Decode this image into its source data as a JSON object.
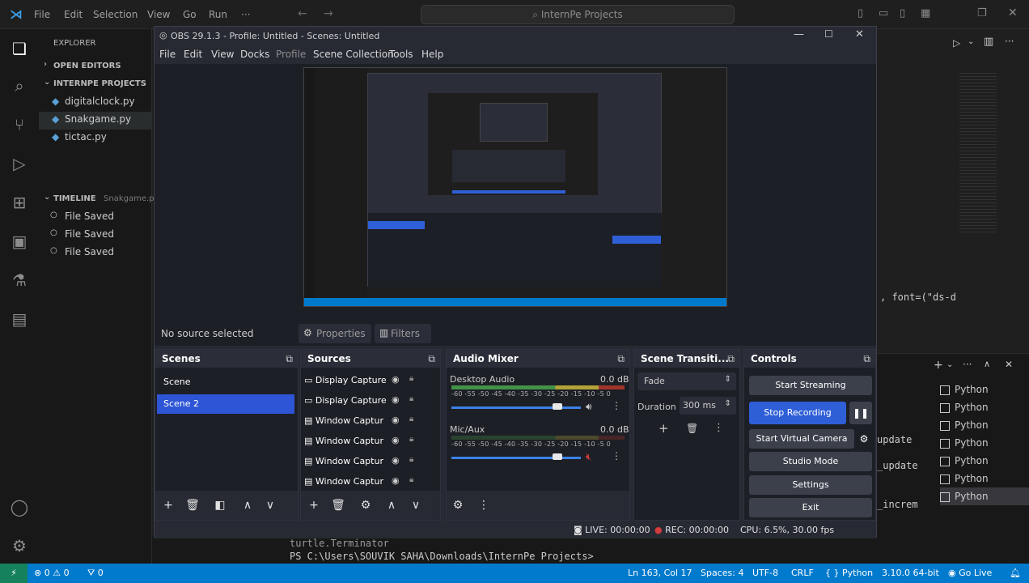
{
  "vscode": {
    "menu": [
      "File",
      "Edit",
      "Selection",
      "View",
      "Go",
      "Run",
      "···"
    ],
    "search": "InternPe Projects",
    "explorer_title": "EXPLORER",
    "open_editors": "OPEN EDITORS",
    "folder": "INTERNPE PROJECTS",
    "files": [
      "digitalclock.py",
      "Snakgame.py",
      "tictac.py"
    ],
    "timeline": "TIMELINE",
    "timeline_file": "Snakgame.py",
    "timeline_items": [
      "File Saved",
      "File Saved",
      "File Saved"
    ],
    "code_fragments": [
      ", font=(\"ds-d",
      "update",
      "_update",
      "_increm"
    ],
    "terminal_list": [
      "Python",
      "Python",
      "Python",
      "Python",
      "Python",
      "Python",
      "Python"
    ],
    "terminal_lines": [
      "turtle.Terminator",
      "PS C:\\Users\\SOUVIK SAHA\\Downloads\\InternPe Projects> "
    ],
    "status": {
      "errors": "0",
      "warnings": "0",
      "ports": "0",
      "position": "Ln 163, Col 17",
      "spaces": "Spaces: 4",
      "encoding": "UTF-8",
      "eol": "CRLF",
      "language": "Python",
      "interpreter": "3.10.0 64-bit",
      "golive": "Go Live"
    }
  },
  "obs": {
    "title": "OBS 29.1.3 - Profile: Untitled - Scenes: Untitled",
    "menu": [
      "File",
      "Edit",
      "View",
      "Docks",
      "Profile",
      "Scene Collection",
      "Tools",
      "Help"
    ],
    "no_source": "No source selected",
    "properties": "Properties",
    "filters": "Filters",
    "scenes_title": "Scenes",
    "scenes": [
      "Scene",
      "Scene 2"
    ],
    "sources_title": "Sources",
    "sources": [
      "Display Capture",
      "Display Capture",
      "Window Captur",
      "Window Captur",
      "Window Captur",
      "Window Captur"
    ],
    "mixer_title": "Audio Mixer",
    "mixer_channels": [
      {
        "name": "Desktop Audio",
        "db": "0.0 dB",
        "level": 0.82
      },
      {
        "name": "Mic/Aux",
        "db": "0.0 dB",
        "level": 0.82
      }
    ],
    "mixer_ticks": "-60 -55 -50 -45 -40 -35 -30 -25 -20 -15 -10 -5 0",
    "transitions_title": "Scene Transiti...",
    "transition": "Fade",
    "duration_label": "Duration",
    "duration_value": "300 ms",
    "controls_title": "Controls",
    "controls": [
      "Start Streaming",
      "Stop Recording",
      "Start Virtual Camera",
      "Studio Mode",
      "Settings",
      "Exit"
    ],
    "status": {
      "live": "LIVE: 00:00:00",
      "rec": "REC: 00:00:00",
      "cpu": "CPU: 6.5%, 30.00 fps"
    },
    "colors": {
      "accent": "#2f5fd7",
      "selected": "#2d55d6"
    }
  }
}
